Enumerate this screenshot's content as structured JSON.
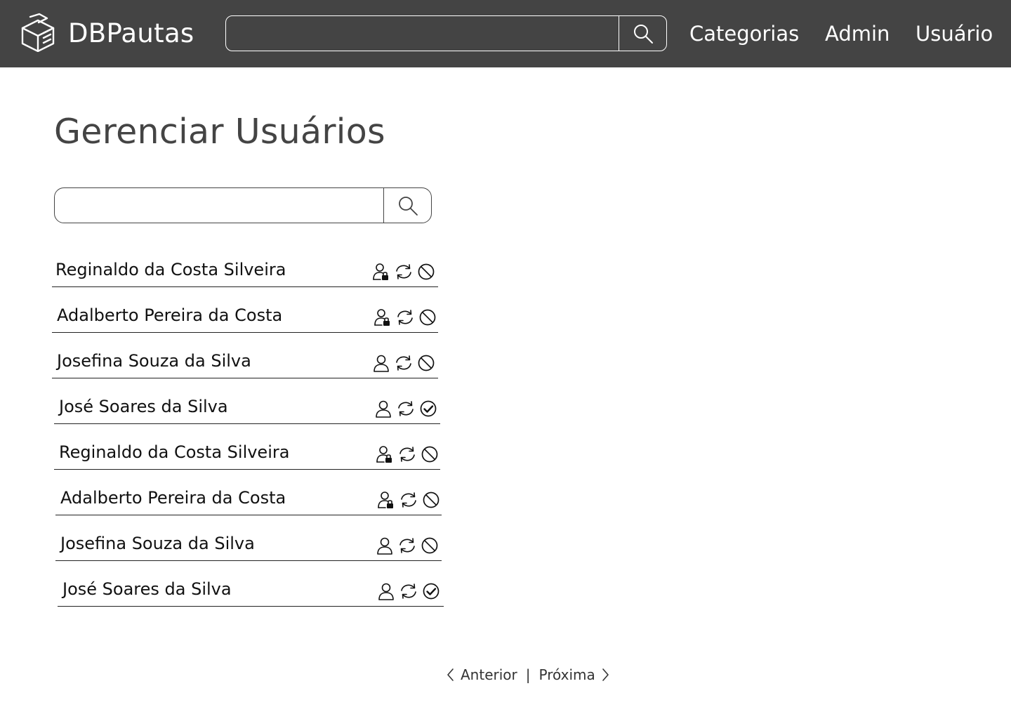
{
  "header": {
    "brand": "DBPautas",
    "search": {
      "placeholder": "",
      "value": ""
    },
    "nav": [
      {
        "label": "Categorias"
      },
      {
        "label": "Admin"
      },
      {
        "label": "Usuário"
      }
    ]
  },
  "main": {
    "title": "Gerenciar Usuários",
    "search": {
      "placeholder": "",
      "value": ""
    },
    "users": [
      {
        "name": "Reginaldo da Costa Silveira",
        "role_icon": "user-lock-icon",
        "status_icon": "block-icon"
      },
      {
        "name": "Adalberto Pereira da Costa",
        "role_icon": "user-lock-icon",
        "status_icon": "block-icon"
      },
      {
        "name": "Josefina Souza da Silva",
        "role_icon": "user-icon",
        "status_icon": "block-icon"
      },
      {
        "name": "José Soares da Silva",
        "role_icon": "user-icon",
        "status_icon": "check-circle-icon"
      },
      {
        "name": "Reginaldo da Costa Silveira",
        "role_icon": "user-lock-icon",
        "status_icon": "block-icon"
      },
      {
        "name": "Adalberto Pereira da Costa",
        "role_icon": "user-lock-icon",
        "status_icon": "block-icon"
      },
      {
        "name": "Josefina Souza da Silva",
        "role_icon": "user-icon",
        "status_icon": "block-icon"
      },
      {
        "name": "José Soares da Silva",
        "role_icon": "user-icon",
        "status_icon": "check-circle-icon"
      }
    ]
  },
  "pagination": {
    "previous_label": "Anterior",
    "separator": "|",
    "next_label": "Próxima"
  },
  "colors": {
    "header_bg": "#444444",
    "header_text": "#ffffff",
    "title_text": "#444444"
  }
}
